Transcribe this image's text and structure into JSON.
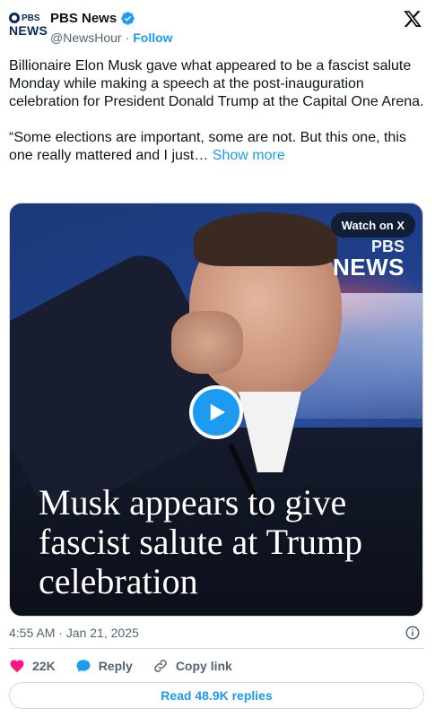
{
  "header": {
    "logo_pbs": "PBS",
    "logo_news": "NEWS",
    "display_name": "PBS News",
    "handle": "@NewsHour",
    "separator": "·",
    "follow_label": "Follow",
    "verified_icon": "verified-badge-icon",
    "platform_icon": "x-logo-icon"
  },
  "tweet": {
    "paragraph_1": "Billionaire Elon Musk gave what appeared to be a fascist salute Monday while making a speech at the post-inauguration celebration for President Donald Trump at the Capital One Arena.",
    "paragraph_2": "“Some elections are important, some are not. But this one, this one really mattered and I just…",
    "show_more_label": "Show more"
  },
  "media": {
    "watch_label": "Watch on X",
    "watermark_pbs": "PBS",
    "watermark_news": "NEWS",
    "headline": "Musk appears to give fascist salute at Trump celebration",
    "play_icon": "play-icon"
  },
  "meta": {
    "timestamp": "4:55 AM · Jan 21, 2025",
    "info_icon": "info-icon"
  },
  "actions": {
    "likes_count": "22K",
    "reply_label": "Reply",
    "copy_link_label": "Copy link"
  },
  "replies_button": "Read 48.9K replies",
  "colors": {
    "accent": "#1d9bf0",
    "like": "#f91880",
    "text": "#0f1419",
    "muted": "#536471",
    "border": "#cfd9de"
  }
}
